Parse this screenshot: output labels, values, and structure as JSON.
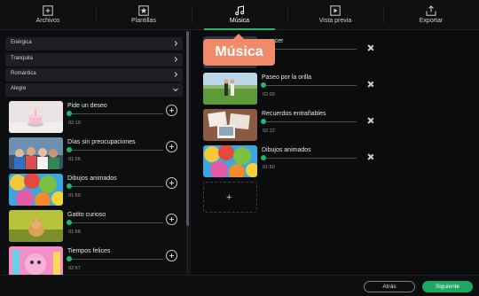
{
  "tabs": [
    {
      "label": "Archivos",
      "icon": "add-media-icon"
    },
    {
      "label": "Plantillas",
      "icon": "star-template-icon"
    },
    {
      "label": "Música",
      "icon": "music-note-icon",
      "active": true
    },
    {
      "label": "Vista previa",
      "icon": "play-preview-icon"
    },
    {
      "label": "Exportar",
      "icon": "export-icon"
    }
  ],
  "categories": [
    {
      "label": "Enérgica"
    },
    {
      "label": "Tranquila"
    },
    {
      "label": "Romántica"
    },
    {
      "label": "Alegre"
    }
  ],
  "library_tracks": [
    {
      "title": "Pide un deseo",
      "duration": "02:19",
      "thumb": "cake-candle"
    },
    {
      "title": "Días sin preocupaciones",
      "duration": "01:56",
      "thumb": "friends-group"
    },
    {
      "title": "Dibujos animados",
      "duration": "01:50",
      "thumb": "balloons"
    },
    {
      "title": "Gatito curioso",
      "duration": "01:58",
      "thumb": "kitten"
    },
    {
      "title": "Tiempos felices",
      "duration": "02:57",
      "thumb": "pink-toy"
    }
  ],
  "selected_tracks": [
    {
      "title": "…necer",
      "duration": "",
      "thumb": "hidden"
    },
    {
      "title": "Paseo por la orilla",
      "duration": "02:00",
      "thumb": "meadow-walk"
    },
    {
      "title": "Recuerdos entrañables",
      "duration": "02:12",
      "thumb": "photos"
    },
    {
      "title": "Dibujos animados",
      "duration": "01:50",
      "thumb": "balloons"
    }
  ],
  "add_slot": {
    "symbol": "+"
  },
  "tooltip": {
    "text": "Música"
  },
  "footer": {
    "back_label": "Atrás",
    "next_label": "Siguiente"
  },
  "colors": {
    "accent": "#1fb86a",
    "tooltip": "#f08a68",
    "background": "#0b0c0e"
  }
}
